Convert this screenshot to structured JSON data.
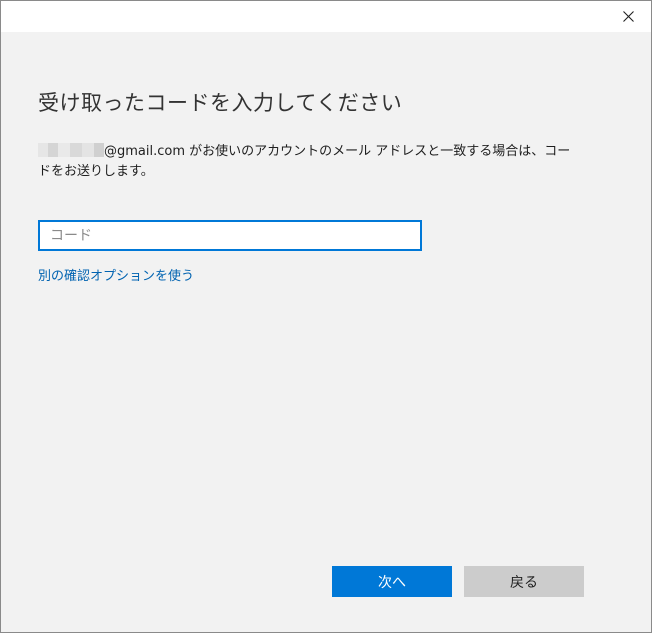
{
  "titlebar": {
    "close_icon": "close-icon"
  },
  "heading": "受け取ったコードを入力してください",
  "description": {
    "email_domain": "@gmail.com",
    "text": " がお使いのアカウントのメール アドレスと一致する場合は、コードをお送りします。"
  },
  "code_field": {
    "placeholder": "コード",
    "value": ""
  },
  "alt_option_link": "別の確認オプションを使う",
  "buttons": {
    "next_label": "次へ",
    "back_label": "戻る"
  },
  "colors": {
    "accent": "#0078d7",
    "link": "#0063b1",
    "background": "#f2f2f2",
    "secondary_button": "#cccccc"
  }
}
